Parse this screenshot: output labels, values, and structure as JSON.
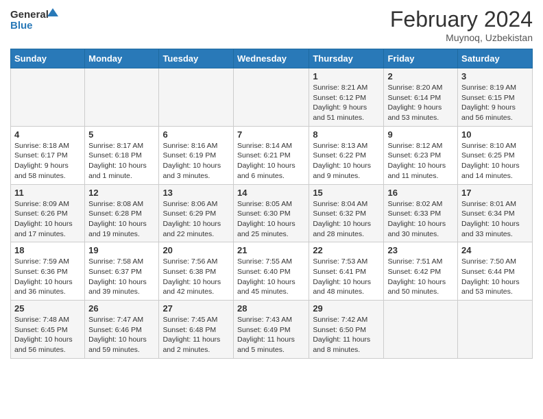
{
  "header": {
    "logo_line1": "General",
    "logo_line2": "Blue",
    "month_title": "February 2024",
    "subtitle": "Muynoq, Uzbekistan"
  },
  "days_of_week": [
    "Sunday",
    "Monday",
    "Tuesday",
    "Wednesday",
    "Thursday",
    "Friday",
    "Saturday"
  ],
  "weeks": [
    [
      {
        "day": "",
        "info": ""
      },
      {
        "day": "",
        "info": ""
      },
      {
        "day": "",
        "info": ""
      },
      {
        "day": "",
        "info": ""
      },
      {
        "day": "1",
        "info": "Sunrise: 8:21 AM\nSunset: 6:12 PM\nDaylight: 9 hours and 51 minutes."
      },
      {
        "day": "2",
        "info": "Sunrise: 8:20 AM\nSunset: 6:14 PM\nDaylight: 9 hours and 53 minutes."
      },
      {
        "day": "3",
        "info": "Sunrise: 8:19 AM\nSunset: 6:15 PM\nDaylight: 9 hours and 56 minutes."
      }
    ],
    [
      {
        "day": "4",
        "info": "Sunrise: 8:18 AM\nSunset: 6:17 PM\nDaylight: 9 hours and 58 minutes."
      },
      {
        "day": "5",
        "info": "Sunrise: 8:17 AM\nSunset: 6:18 PM\nDaylight: 10 hours and 1 minute."
      },
      {
        "day": "6",
        "info": "Sunrise: 8:16 AM\nSunset: 6:19 PM\nDaylight: 10 hours and 3 minutes."
      },
      {
        "day": "7",
        "info": "Sunrise: 8:14 AM\nSunset: 6:21 PM\nDaylight: 10 hours and 6 minutes."
      },
      {
        "day": "8",
        "info": "Sunrise: 8:13 AM\nSunset: 6:22 PM\nDaylight: 10 hours and 9 minutes."
      },
      {
        "day": "9",
        "info": "Sunrise: 8:12 AM\nSunset: 6:23 PM\nDaylight: 10 hours and 11 minutes."
      },
      {
        "day": "10",
        "info": "Sunrise: 8:10 AM\nSunset: 6:25 PM\nDaylight: 10 hours and 14 minutes."
      }
    ],
    [
      {
        "day": "11",
        "info": "Sunrise: 8:09 AM\nSunset: 6:26 PM\nDaylight: 10 hours and 17 minutes."
      },
      {
        "day": "12",
        "info": "Sunrise: 8:08 AM\nSunset: 6:28 PM\nDaylight: 10 hours and 19 minutes."
      },
      {
        "day": "13",
        "info": "Sunrise: 8:06 AM\nSunset: 6:29 PM\nDaylight: 10 hours and 22 minutes."
      },
      {
        "day": "14",
        "info": "Sunrise: 8:05 AM\nSunset: 6:30 PM\nDaylight: 10 hours and 25 minutes."
      },
      {
        "day": "15",
        "info": "Sunrise: 8:04 AM\nSunset: 6:32 PM\nDaylight: 10 hours and 28 minutes."
      },
      {
        "day": "16",
        "info": "Sunrise: 8:02 AM\nSunset: 6:33 PM\nDaylight: 10 hours and 30 minutes."
      },
      {
        "day": "17",
        "info": "Sunrise: 8:01 AM\nSunset: 6:34 PM\nDaylight: 10 hours and 33 minutes."
      }
    ],
    [
      {
        "day": "18",
        "info": "Sunrise: 7:59 AM\nSunset: 6:36 PM\nDaylight: 10 hours and 36 minutes."
      },
      {
        "day": "19",
        "info": "Sunrise: 7:58 AM\nSunset: 6:37 PM\nDaylight: 10 hours and 39 minutes."
      },
      {
        "day": "20",
        "info": "Sunrise: 7:56 AM\nSunset: 6:38 PM\nDaylight: 10 hours and 42 minutes."
      },
      {
        "day": "21",
        "info": "Sunrise: 7:55 AM\nSunset: 6:40 PM\nDaylight: 10 hours and 45 minutes."
      },
      {
        "day": "22",
        "info": "Sunrise: 7:53 AM\nSunset: 6:41 PM\nDaylight: 10 hours and 48 minutes."
      },
      {
        "day": "23",
        "info": "Sunrise: 7:51 AM\nSunset: 6:42 PM\nDaylight: 10 hours and 50 minutes."
      },
      {
        "day": "24",
        "info": "Sunrise: 7:50 AM\nSunset: 6:44 PM\nDaylight: 10 hours and 53 minutes."
      }
    ],
    [
      {
        "day": "25",
        "info": "Sunrise: 7:48 AM\nSunset: 6:45 PM\nDaylight: 10 hours and 56 minutes."
      },
      {
        "day": "26",
        "info": "Sunrise: 7:47 AM\nSunset: 6:46 PM\nDaylight: 10 hours and 59 minutes."
      },
      {
        "day": "27",
        "info": "Sunrise: 7:45 AM\nSunset: 6:48 PM\nDaylight: 11 hours and 2 minutes."
      },
      {
        "day": "28",
        "info": "Sunrise: 7:43 AM\nSunset: 6:49 PM\nDaylight: 11 hours and 5 minutes."
      },
      {
        "day": "29",
        "info": "Sunrise: 7:42 AM\nSunset: 6:50 PM\nDaylight: 11 hours and 8 minutes."
      },
      {
        "day": "",
        "info": ""
      },
      {
        "day": "",
        "info": ""
      }
    ]
  ]
}
